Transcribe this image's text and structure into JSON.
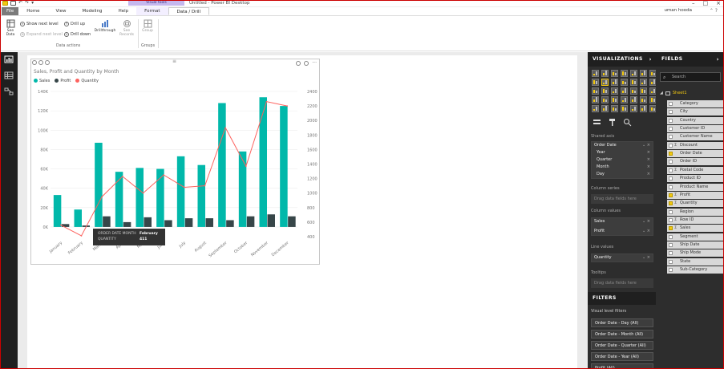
{
  "titlebar": {
    "context_group": "Visual tools",
    "title": "Untitled - Power BI Desktop",
    "user": "uman hooda"
  },
  "tabs": [
    {
      "label": "File"
    },
    {
      "label": "Home"
    },
    {
      "label": "View"
    },
    {
      "label": "Modeling"
    },
    {
      "label": "Help"
    },
    {
      "label": "Format"
    },
    {
      "label": "Data / Drill"
    }
  ],
  "ribbon": {
    "see_data": "See Data",
    "show_next_level": "Show next level",
    "expand_next_level": "Expand next level",
    "drill_up": "Drill up",
    "drill_down": "Drill down",
    "drillthrough": "Drillthrough",
    "see_records": "See Records",
    "group": "Group",
    "group_data_actions": "Data actions",
    "group_groups": "Groups"
  },
  "visual": {
    "title": "Sales, Profit and Quantity by Month",
    "legend": [
      {
        "name": "Sales",
        "color": "#01b8aa"
      },
      {
        "name": "Profit",
        "color": "#374649"
      },
      {
        "name": "Quantity",
        "color": "#fd625e"
      }
    ],
    "tooltip": {
      "label1": "ORDER DATE MONTH",
      "value1": "February",
      "label2": "QUANTITY",
      "value2": "411"
    }
  },
  "chart_data": {
    "type": "bar",
    "title": "Sales, Profit and Quantity by Month",
    "categories": [
      "January",
      "February",
      "March",
      "April",
      "May",
      "June",
      "July",
      "August",
      "September",
      "October",
      "November",
      "December"
    ],
    "series": [
      {
        "name": "Sales",
        "kind": "bar",
        "axis": "left",
        "color": "#01b8aa",
        "values": [
          33000,
          18000,
          87000,
          57000,
          61000,
          60000,
          73000,
          64000,
          128000,
          78000,
          134000,
          125000
        ]
      },
      {
        "name": "Profit",
        "kind": "bar",
        "axis": "left",
        "color": "#374649",
        "values": [
          3000,
          1500,
          11000,
          5000,
          10000,
          7000,
          9000,
          9000,
          7000,
          11000,
          13000,
          11000
        ]
      },
      {
        "name": "Quantity",
        "kind": "line",
        "axis": "right",
        "color": "#fd625e",
        "values": [
          560,
          411,
          950,
          1230,
          1000,
          1250,
          1080,
          1100,
          1900,
          1370,
          2260,
          2200
        ]
      }
    ],
    "y_left": {
      "ticks": [
        "0K",
        "20K",
        "40K",
        "60K",
        "80K",
        "100K",
        "120K",
        "140K"
      ],
      "range": [
        -10000,
        140000
      ]
    },
    "y_right": {
      "ticks": [
        "400",
        "600",
        "800",
        "1000",
        "1200",
        "1400",
        "1600",
        "1800",
        "2000",
        "2200",
        "2400"
      ],
      "range": [
        400,
        2400
      ]
    },
    "legend_position": "top-left",
    "grid": true
  },
  "visualizations": {
    "header": "VISUALIZATIONS",
    "sections": {
      "shared_axis": "Shared axis",
      "column_series": "Column series",
      "column_values": "Column values",
      "line_values": "Line values",
      "tooltips": "Tooltips",
      "drag_here": "Drag data fields here"
    },
    "shared_axis_items": [
      "Order Date",
      "Year",
      "Quarter",
      "Month",
      "Day"
    ],
    "column_values_items": [
      "Sales",
      "Profit"
    ],
    "line_values_items": [
      "Quantity"
    ]
  },
  "filters": {
    "header": "FILTERS",
    "visual_level": "Visual level filters",
    "items": [
      "Order Date - Day (All)",
      "Order Date - Month (All)",
      "Order Date - Quarter (All)",
      "Order Date - Year (All)",
      "Profit (All)"
    ]
  },
  "fields": {
    "header": "FIELDS",
    "search_placeholder": "Search",
    "table": "Sheet1",
    "items": [
      {
        "name": "Category",
        "checked": false,
        "sigma": false
      },
      {
        "name": "City",
        "checked": false,
        "sigma": false
      },
      {
        "name": "Country",
        "checked": false,
        "sigma": false
      },
      {
        "name": "Customer ID",
        "checked": false,
        "sigma": false
      },
      {
        "name": "Customer Name",
        "checked": false,
        "sigma": false
      },
      {
        "name": "Discount",
        "checked": false,
        "sigma": true
      },
      {
        "name": "Order Date",
        "checked": true,
        "sigma": false
      },
      {
        "name": "Order ID",
        "checked": false,
        "sigma": false
      },
      {
        "name": "Postal Code",
        "checked": false,
        "sigma": true
      },
      {
        "name": "Product ID",
        "checked": false,
        "sigma": false
      },
      {
        "name": "Product Name",
        "checked": false,
        "sigma": false
      },
      {
        "name": "Profit",
        "checked": true,
        "sigma": true
      },
      {
        "name": "Quantity",
        "checked": true,
        "sigma": true
      },
      {
        "name": "Region",
        "checked": false,
        "sigma": false
      },
      {
        "name": "Row ID",
        "checked": false,
        "sigma": true
      },
      {
        "name": "Sales",
        "checked": true,
        "sigma": true
      },
      {
        "name": "Segment",
        "checked": false,
        "sigma": false
      },
      {
        "name": "Ship Date",
        "checked": false,
        "sigma": false
      },
      {
        "name": "Ship Mode",
        "checked": false,
        "sigma": false
      },
      {
        "name": "State",
        "checked": false,
        "sigma": false
      },
      {
        "name": "Sub-Category",
        "checked": false,
        "sigma": false
      }
    ]
  }
}
